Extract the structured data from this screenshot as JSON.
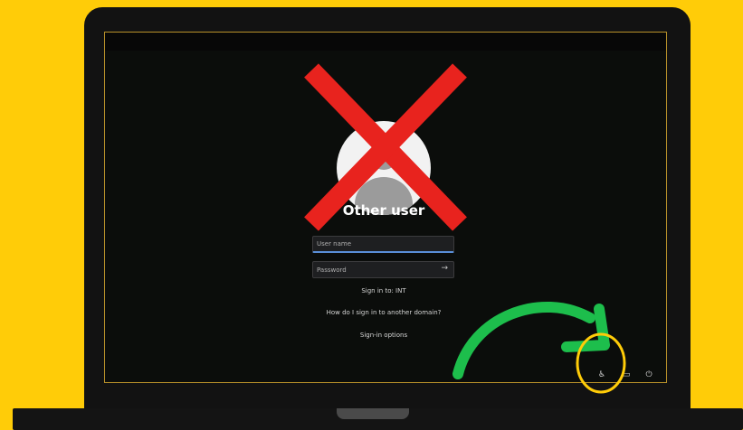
{
  "login": {
    "title": "Other user",
    "username_placeholder": "User name",
    "password_placeholder": "Password",
    "submit_arrow": "→",
    "sign_in_to": "Sign in to: INT",
    "domain_help": "How do I sign in to another domain?",
    "sign_in_options": "Sign-in options"
  },
  "tray": {
    "accessibility_glyph": "♿",
    "network_glyph": "▭",
    "power_glyph": "⏻"
  },
  "colors": {
    "background": "#FFCC08",
    "cross": "#E8231E",
    "arrow": "#1DBE4C",
    "highlight_circle": "#FFCC08"
  }
}
